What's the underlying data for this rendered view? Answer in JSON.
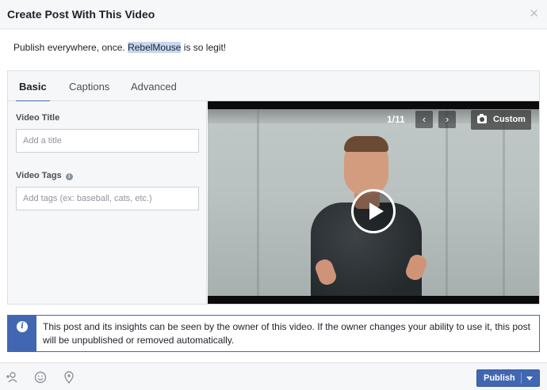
{
  "dialog": {
    "title": "Create Post With This Video",
    "close_icon": "close-icon"
  },
  "composer": {
    "text_before": "Publish everywhere, once. ",
    "text_highlight": "RebelMouse",
    "text_after": " is so legit!"
  },
  "tabs": [
    {
      "label": "Basic",
      "active": true
    },
    {
      "label": "Captions",
      "active": false
    },
    {
      "label": "Advanced",
      "active": false
    }
  ],
  "fields": {
    "title_label": "Video Title",
    "title_placeholder": "Add a title",
    "tags_label": "Video Tags",
    "tags_placeholder": "Add tags (ex: baseball, cats, etc.)"
  },
  "video": {
    "counter": "1/11",
    "prev_icon": "chevron-left-icon",
    "next_icon": "chevron-right-icon",
    "custom_label": "Custom",
    "custom_icon": "camera-icon",
    "play_icon": "play-icon"
  },
  "notice": {
    "icon": "info-icon",
    "text": "This post and its insights can be seen by the owner of this video. If the owner changes your ability to use it, this post will be unpublished or removed automatically."
  },
  "footer": {
    "icons": [
      "tag-people-icon",
      "emoji-icon",
      "location-pin-icon"
    ],
    "publish_label": "Publish"
  },
  "colors": {
    "accent": "#4267b2",
    "header_bg": "#f6f7f9",
    "highlight": "#c9d7f1"
  }
}
